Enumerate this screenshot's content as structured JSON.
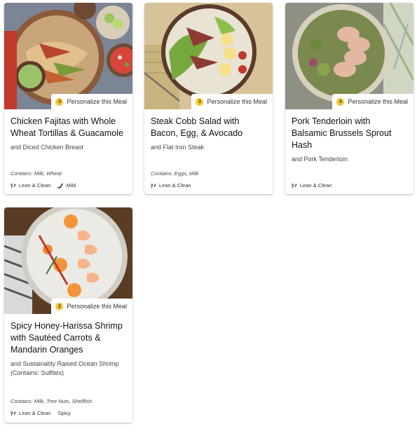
{
  "meals": [
    {
      "badge_count": "3",
      "personalize_label": "Personalize this Meal",
      "title": "Chicken Fajitas with Whole Wheat Tortillas & Guacamole",
      "subtitle": "and Diced Chicken Breast",
      "contains": "Contains: Milk, Wheat",
      "tags": [
        {
          "label": "Lean & Clean",
          "icon": "fork-leaf-icon"
        },
        {
          "label": "Mild",
          "icon": "chili-pepper-icon"
        }
      ]
    },
    {
      "badge_count": "3",
      "personalize_label": "Personalize this Meal",
      "title": "Steak Cobb Salad with Bacon, Egg, & Avocado",
      "subtitle": "and Flat Iron Steak",
      "contains": "Contains: Eggs, Milk",
      "tags": [
        {
          "label": "Lean & Clean",
          "icon": "fork-leaf-icon"
        }
      ]
    },
    {
      "badge_count": "4",
      "personalize_label": "Personalize this Meal",
      "title": "Pork Tenderloin with Balsamic Brussels Sprout Hash",
      "subtitle": "and Pork Tenderloin",
      "contains": "",
      "tags": [
        {
          "label": "Lean & Clean",
          "icon": "fork-leaf-icon"
        }
      ]
    },
    {
      "badge_count": "2",
      "personalize_label": "Personalize this Meal",
      "title": "Spicy Honey-Harissa Shrimp with Sautéed Carrots & Mandarin Oranges",
      "subtitle": "and Sustainably Raised Ocean Shrimp (Contains: Sulfites)",
      "contains": "Contains: Milk, Tree Nuts, Shellfish",
      "tags": [
        {
          "label": "Lean & Clean",
          "icon": "fork-leaf-icon"
        },
        {
          "label": "Spicy",
          "icon": ""
        }
      ]
    }
  ],
  "colors": {
    "badge": "#f3c93b"
  }
}
